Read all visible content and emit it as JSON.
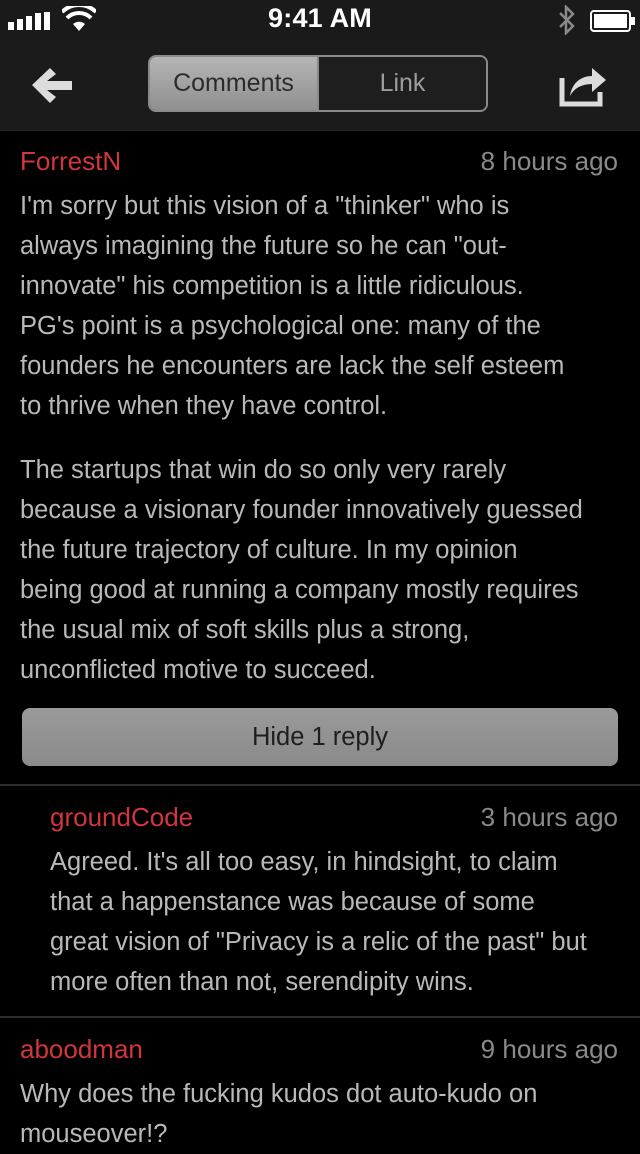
{
  "status_bar": {
    "time": "9:41 AM"
  },
  "nav": {
    "tabs": [
      {
        "label": "Comments",
        "active": true
      },
      {
        "label": "Link",
        "active": false
      }
    ],
    "back_icon": "back-arrow-icon",
    "share_icon": "share-icon"
  },
  "colors": {
    "author": "#d2363d",
    "background": "#000000",
    "text": "#b9b9b9"
  },
  "comments": [
    {
      "author": "ForrestN",
      "time": "8 hours ago",
      "paragraphs": [
        [
          "I'm sorry but this vision of a \"thinker\" who is",
          "always imagining the future so he can \"out-",
          "innovate\" his competition is a little ridiculous.",
          "PG's point is a psychological one: many of the",
          "founders he encounters are lack the self esteem",
          "to thrive when they have control."
        ],
        [
          "The startups that win do so only very rarely",
          "because a visionary founder innovatively guessed",
          "the future trajectory of culture. In my opinion",
          "being good at running a company mostly requires",
          "the usual mix of soft skills plus a strong,",
          "unconflicted motive to succeed."
        ]
      ],
      "replies_button": "Hide 1 reply"
    },
    {
      "author": "groundCode",
      "time": "3 hours ago",
      "paragraphs": [
        [
          "Agreed. It's all too easy, in hindsight, to claim",
          "that a happenstance was because of some",
          "great vision of \"Privacy is a relic of the past\" but",
          "more often than not, serendipity wins."
        ]
      ]
    },
    {
      "author": "aboodman",
      "time": "9 hours ago",
      "paragraphs": [
        [
          "Why does the fucking kudos dot auto-kudo on",
          "mouseover!?"
        ]
      ]
    }
  ]
}
